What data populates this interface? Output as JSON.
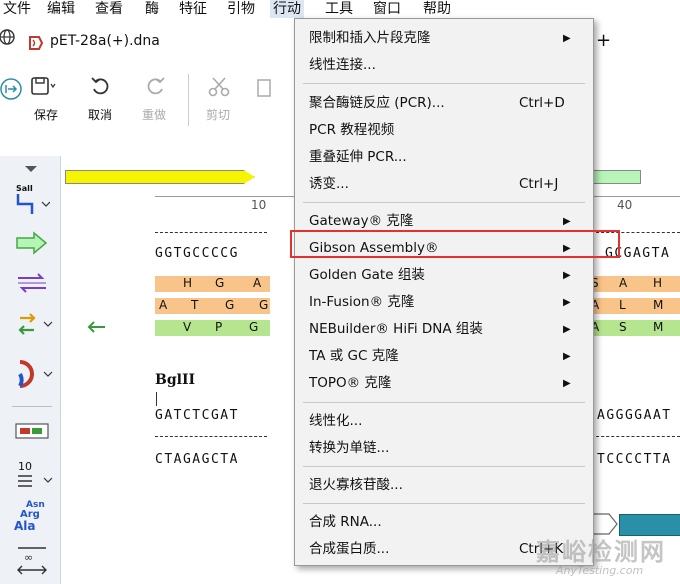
{
  "menubar": {
    "items": [
      "文件",
      "编辑",
      "查看",
      "酶",
      "特征",
      "引物",
      "行动",
      "工具",
      "窗口",
      "帮助"
    ],
    "active_index": 6
  },
  "tab": {
    "title": "pET-28a(+).dna",
    "plus": "+"
  },
  "toolbar": {
    "save": "保存",
    "undo": "取消",
    "redo": "重做",
    "cut": "剪切"
  },
  "gutter": {
    "sali_label": "SalI",
    "number_label": "10",
    "asn": "Asn",
    "arg": "Arg",
    "ala": "Ala"
  },
  "sequence": {
    "ruler_10": "10",
    "ruler_40": "40",
    "row1_left": "GGTGCCCCG",
    "row1_right": "GCGAGTA",
    "aa1_left": [
      "H",
      "G",
      "A"
    ],
    "aa1_right": [
      "S",
      "A",
      "H"
    ],
    "aa2_left": [
      "A",
      "T",
      "G",
      "G"
    ],
    "aa2_right": [
      "A",
      "L",
      "M"
    ],
    "aa3_left": [
      "V",
      "P",
      "G"
    ],
    "aa3_right": [
      "A",
      "S",
      "M"
    ],
    "enzyme": "BglII",
    "row2_top_left": "GATCTCGAT",
    "row2_top_right": "AGGGGAAT",
    "row2_bot_left": "CTAGAGCTA",
    "row2_bot_right": "TCCCCTTA"
  },
  "menu": {
    "items": [
      {
        "label": "限制和插入片段克隆",
        "shortcut": "",
        "submenu": true
      },
      {
        "label": "线性连接...",
        "shortcut": "",
        "submenu": false
      },
      {
        "label": "聚合酶链反应 (PCR)...",
        "shortcut": "Ctrl+D",
        "submenu": false
      },
      {
        "label": "PCR 教程视频",
        "shortcut": "",
        "submenu": false
      },
      {
        "label": "重叠延伸 PCR...",
        "shortcut": "",
        "submenu": false
      },
      {
        "label": "诱变...",
        "shortcut": "Ctrl+J",
        "submenu": false
      },
      {
        "label": "Gateway® 克隆",
        "shortcut": "",
        "submenu": true
      },
      {
        "label": "Gibson Assembly®",
        "shortcut": "",
        "submenu": true
      },
      {
        "label": "Golden Gate 组装",
        "shortcut": "",
        "submenu": true
      },
      {
        "label": "In-Fusion® 克隆",
        "shortcut": "",
        "submenu": true
      },
      {
        "label": "NEBuilder® HiFi DNA 组装",
        "shortcut": "",
        "submenu": true
      },
      {
        "label": "TA 或 GC 克隆",
        "shortcut": "",
        "submenu": true
      },
      {
        "label": "TOPO® 克隆",
        "shortcut": "",
        "submenu": true
      },
      {
        "label": "线性化...",
        "shortcut": "",
        "submenu": false
      },
      {
        "label": "转换为单链...",
        "shortcut": "",
        "submenu": false
      },
      {
        "label": "退火寡核苷酸...",
        "shortcut": "",
        "submenu": false
      },
      {
        "label": "合成 RNA...",
        "shortcut": "",
        "submenu": false
      },
      {
        "label": "合成蛋白质...",
        "shortcut": "Ctrl+K",
        "submenu": false
      }
    ],
    "arrow_glyph": "▶"
  },
  "watermark": {
    "cn": "嘉峪检测网",
    "en": "AnyTesting.com"
  },
  "colors": {
    "highlight_border": "#e53030",
    "feature_yellow": "#f5f500",
    "feature_green": "#b8f5b8",
    "aa_orange": "#f9c489",
    "aa_green": "#b6e58f",
    "accent_teal": "#2a8fa8"
  }
}
